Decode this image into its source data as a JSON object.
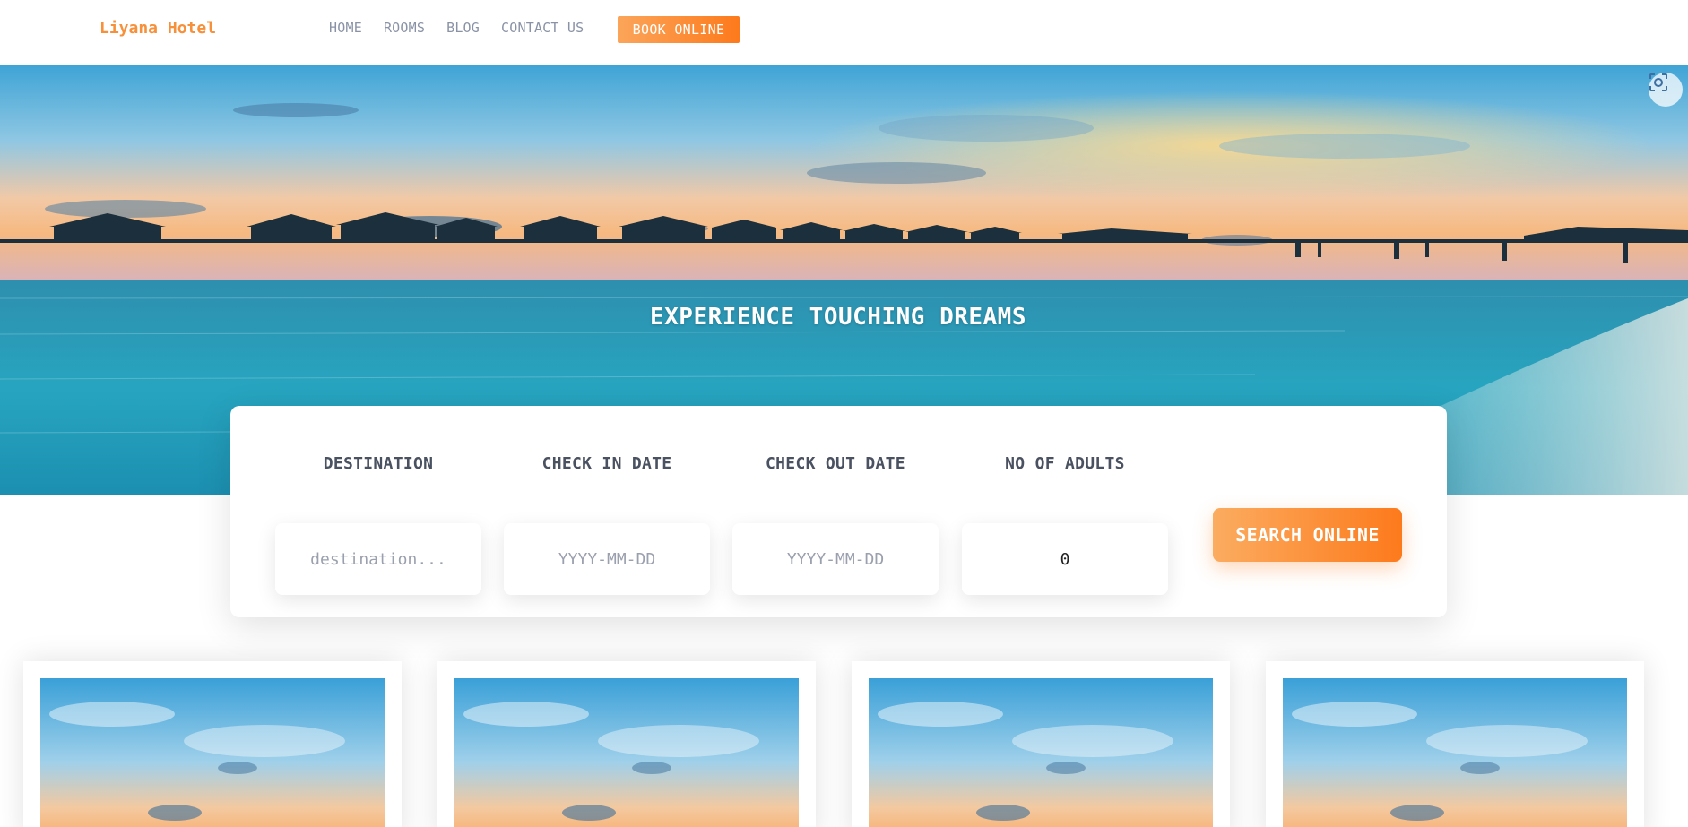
{
  "brand": {
    "name": "Liyana Hotel"
  },
  "nav": {
    "links": [
      "HOME",
      "ROOMS",
      "BLOG",
      "CONTACT US"
    ],
    "book_label": "BOOK ONLINE"
  },
  "hero": {
    "title": "EXPERIENCE TOUCHING DREAMS"
  },
  "search": {
    "fields": [
      {
        "label": "DESTINATION",
        "placeholder": "destination...",
        "value": ""
      },
      {
        "label": "CHECK IN DATE",
        "placeholder": "YYYY-MM-DD",
        "value": ""
      },
      {
        "label": "CHECK OUT DATE",
        "placeholder": "YYYY-MM-DD",
        "value": ""
      },
      {
        "label": "NO OF ADULTS",
        "placeholder": "",
        "value": "0"
      }
    ],
    "button_label": "SEARCH ONLINE"
  },
  "colors": {
    "accent": "#fd7a1c",
    "accent_light": "#fba55a",
    "nav_text": "#8a93a6",
    "label_text": "#4a5160"
  },
  "icons": {
    "hero_corner": "scan-icon"
  },
  "cards": [
    {
      "image": "sky-image"
    },
    {
      "image": "sky-image"
    },
    {
      "image": "sky-image"
    },
    {
      "image": "sky-image"
    }
  ]
}
